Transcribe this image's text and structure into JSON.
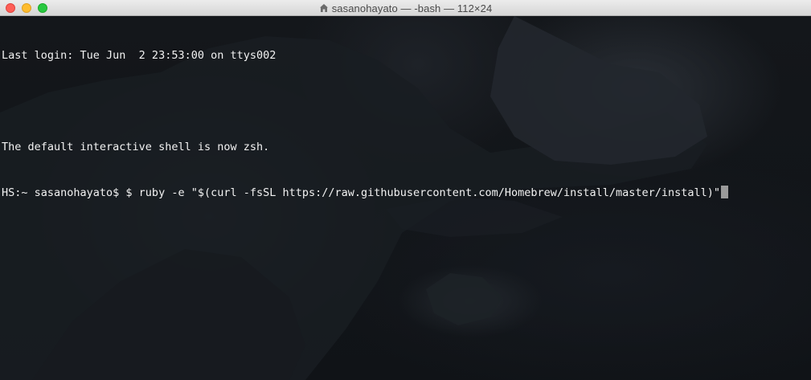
{
  "window": {
    "title": "sasanohayato — -bash — 112×24"
  },
  "terminal": {
    "lines": [
      "Last login: Tue Jun  2 23:53:00 on ttys002",
      "",
      "The default interactive shell is now zsh.",
      "HS:~ sasanohayato$ $ ruby -e \"$(curl -fsSL https://raw.githubusercontent.com/Homebrew/install/master/install)\""
    ]
  },
  "colors": {
    "close": "#fe5f57",
    "minimize": "#febc2e",
    "zoom": "#28c840",
    "text": "#f2f2f2",
    "cursor": "#9a9a9a"
  },
  "icons": {
    "title_icon": "home-folder-icon"
  }
}
